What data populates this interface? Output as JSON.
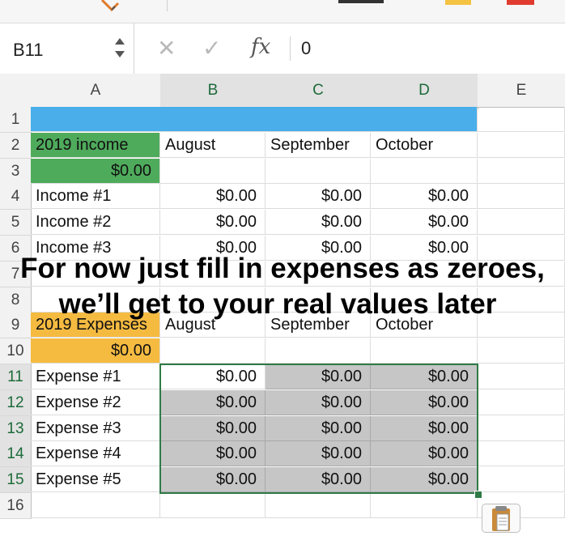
{
  "formula_bar": {
    "cell_ref": "B11",
    "cancel_icon": "close-icon",
    "enter_icon": "check-icon",
    "fx_label": "fx",
    "value": "0"
  },
  "columns": [
    "A",
    "B",
    "C",
    "D",
    "E"
  ],
  "rows": [
    "1",
    "2",
    "3",
    "4",
    "5",
    "6",
    "7",
    "8",
    "9",
    "10",
    "11",
    "12",
    "13",
    "14",
    "15",
    "16"
  ],
  "income": {
    "title": "2019 income",
    "total": "$0.00",
    "months": [
      "August",
      "September",
      "October"
    ],
    "items": [
      {
        "label": "Income #1",
        "values": [
          "$0.00",
          "$0.00",
          "$0.00"
        ]
      },
      {
        "label": "Income #2",
        "values": [
          "$0.00",
          "$0.00",
          "$0.00"
        ]
      },
      {
        "label": "Income #3",
        "values": [
          "$0.00",
          "$0.00",
          "$0.00"
        ]
      }
    ]
  },
  "expenses": {
    "title": "2019 Expenses",
    "total": "$0.00",
    "months": [
      "August",
      "September",
      "October"
    ],
    "items": [
      {
        "label": "Expense #1",
        "values": [
          "$0.00",
          "$0.00",
          "$0.00"
        ]
      },
      {
        "label": "Expense #2",
        "values": [
          "$0.00",
          "$0.00",
          "$0.00"
        ]
      },
      {
        "label": "Expense #3",
        "values": [
          "$0.00",
          "$0.00",
          "$0.00"
        ]
      },
      {
        "label": "Expense #4",
        "values": [
          "$0.00",
          "$0.00",
          "$0.00"
        ]
      },
      {
        "label": "Expense #5",
        "values": [
          "$0.00",
          "$0.00",
          "$0.00"
        ]
      }
    ]
  },
  "overlay": {
    "line1": "For now just fill in expenses as zeroes,",
    "line2": "we’ll get to your real values later"
  },
  "colors": {
    "header_band": "#49aeea",
    "income_header": "#4fab5c",
    "expenses_header": "#f5bb41",
    "selection": "#2f7a46",
    "selected_fill": "#c6c6c6"
  },
  "paste_icon": "clipboard-icon"
}
